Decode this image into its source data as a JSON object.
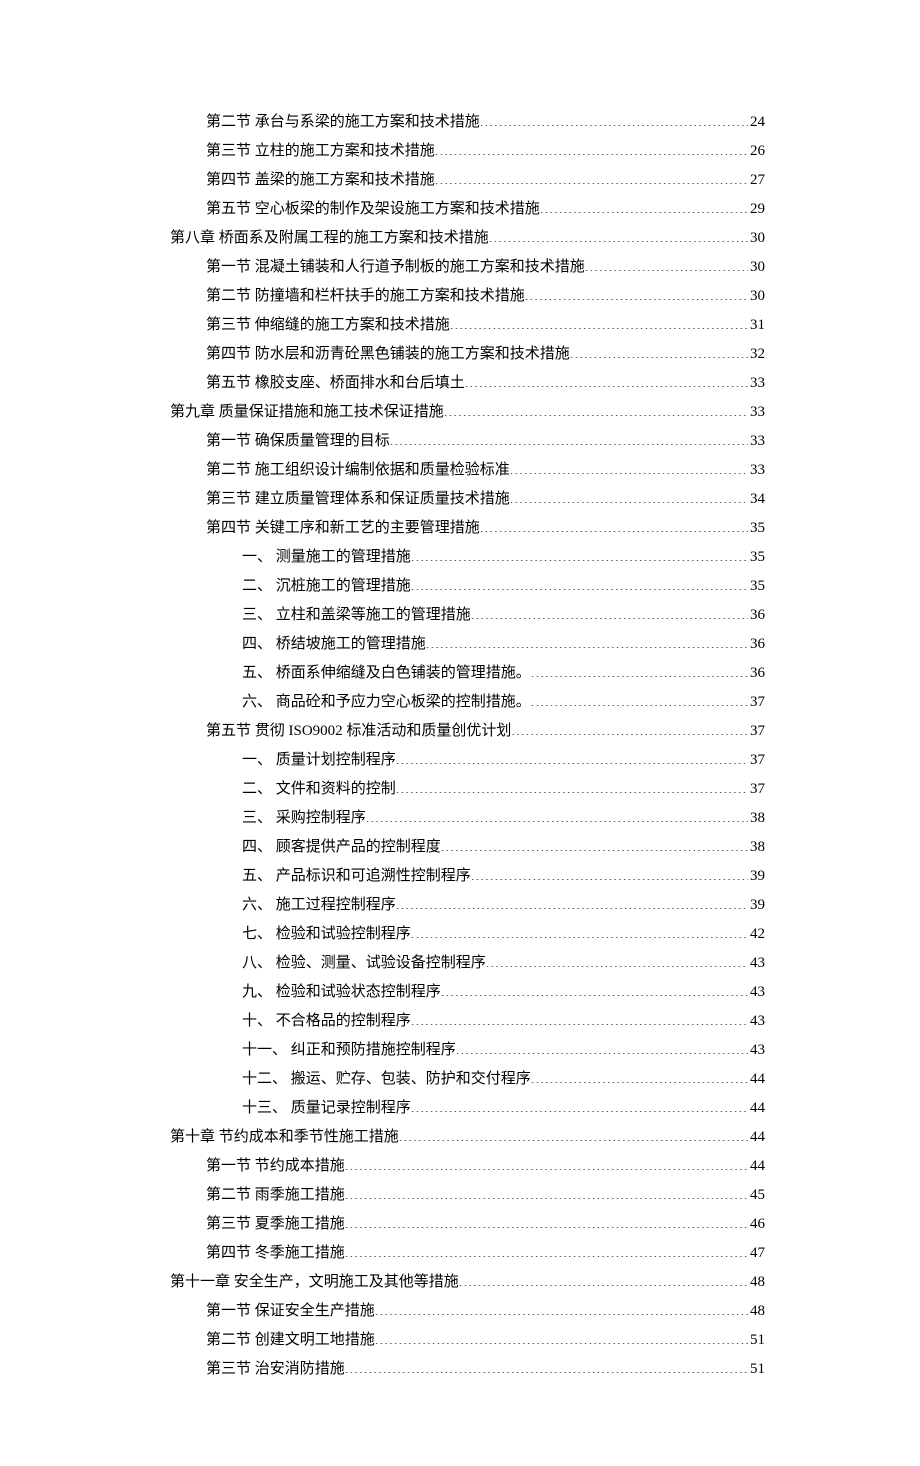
{
  "toc": [
    {
      "indent": 2,
      "label": "第二节 承台与系梁的施工方案和技术措施",
      "page": "24"
    },
    {
      "indent": 2,
      "label": "第三节 立柱的施工方案和技术措施",
      "page": "26"
    },
    {
      "indent": 2,
      "label": "第四节 盖梁的施工方案和技术措施",
      "page": "27"
    },
    {
      "indent": 2,
      "label": "第五节 空心板梁的制作及架设施工方案和技术措施",
      "page": "29"
    },
    {
      "indent": 1,
      "label": "第八章 桥面系及附属工程的施工方案和技术措施",
      "page": "30"
    },
    {
      "indent": 2,
      "label": "第一节 混凝土铺装和人行道予制板的施工方案和技术措施",
      "page": "30"
    },
    {
      "indent": 2,
      "label": "第二节 防撞墙和栏杆扶手的施工方案和技术措施",
      "page": "30"
    },
    {
      "indent": 2,
      "label": "第三节 伸缩缝的施工方案和技术措施",
      "page": "31"
    },
    {
      "indent": 2,
      "label": "第四节 防水层和沥青砼黑色铺装的施工方案和技术措施",
      "page": "32"
    },
    {
      "indent": 2,
      "label": "第五节 橡胶支座、桥面排水和台后填土",
      "page": "33"
    },
    {
      "indent": 1,
      "label": "第九章 质量保证措施和施工技术保证措施",
      "page": "33"
    },
    {
      "indent": 2,
      "label": "第一节 确保质量管理的目标",
      "page": "33"
    },
    {
      "indent": 2,
      "label": "第二节 施工组织设计编制依据和质量检验标准",
      "page": "33"
    },
    {
      "indent": 2,
      "label": "第三节 建立质量管理体系和保证质量技术措施",
      "page": "34"
    },
    {
      "indent": 2,
      "label": "第四节 关键工序和新工艺的主要管理措施",
      "page": "35"
    },
    {
      "indent": 3,
      "label": "一、 测量施工的管理措施",
      "page": "35"
    },
    {
      "indent": 3,
      "label": "二、 沉桩施工的管理措施",
      "page": "35"
    },
    {
      "indent": 3,
      "label": "三、 立柱和盖梁等施工的管理措施",
      "page": "36"
    },
    {
      "indent": 3,
      "label": "四、 桥结坡施工的管理措施",
      "page": "36"
    },
    {
      "indent": 3,
      "label": "五、 桥面系伸缩缝及白色铺装的管理措施。",
      "page": "36"
    },
    {
      "indent": 3,
      "label": "六、 商品砼和予应力空心板梁的控制措施。",
      "page": "37"
    },
    {
      "indent": 2,
      "label": "第五节 贯彻 ISO9002 标准活动和质量创优计划",
      "page": "37"
    },
    {
      "indent": 3,
      "label": "一、 质量计划控制程序",
      "page": "37"
    },
    {
      "indent": 3,
      "label": "二、 文件和资料的控制",
      "page": "37"
    },
    {
      "indent": 3,
      "label": "三、 采购控制程序",
      "page": "38"
    },
    {
      "indent": 3,
      "label": "四、 顾客提供产品的控制程度",
      "page": "38"
    },
    {
      "indent": 3,
      "label": "五、 产品标识和可追溯性控制程序",
      "page": "39"
    },
    {
      "indent": 3,
      "label": "六、 施工过程控制程序",
      "page": "39"
    },
    {
      "indent": 3,
      "label": "七、 检验和试验控制程序",
      "page": "42"
    },
    {
      "indent": 3,
      "label": "八、 检验、测量、试验设备控制程序",
      "page": "43"
    },
    {
      "indent": 3,
      "label": "九、 检验和试验状态控制程序",
      "page": "43"
    },
    {
      "indent": 3,
      "label": "十、 不合格品的控制程序",
      "page": "43"
    },
    {
      "indent": 3,
      "label": "十一、 纠正和预防措施控制程序",
      "page": "43"
    },
    {
      "indent": 3,
      "label": "十二、 搬运、贮存、包装、防护和交付程序",
      "page": "44"
    },
    {
      "indent": 3,
      "label": "十三、 质量记录控制程序",
      "page": "44"
    },
    {
      "indent": 1,
      "label": "第十章 节约成本和季节性施工措施",
      "page": "44"
    },
    {
      "indent": 2,
      "label": "第一节 节约成本措施",
      "page": "44"
    },
    {
      "indent": 2,
      "label": "第二节 雨季施工措施",
      "page": "45"
    },
    {
      "indent": 2,
      "label": "第三节 夏季施工措施",
      "page": "46"
    },
    {
      "indent": 2,
      "label": "第四节 冬季施工措施",
      "page": "47"
    },
    {
      "indent": 1,
      "label": "第十一章 安全生产，文明施工及其他等措施",
      "page": "48"
    },
    {
      "indent": 2,
      "label": "第一节 保证安全生产措施",
      "page": "48"
    },
    {
      "indent": 2,
      "label": "第二节 创建文明工地措施",
      "page": "51"
    },
    {
      "indent": 2,
      "label": "第三节 治安消防措施",
      "page": "51"
    }
  ]
}
